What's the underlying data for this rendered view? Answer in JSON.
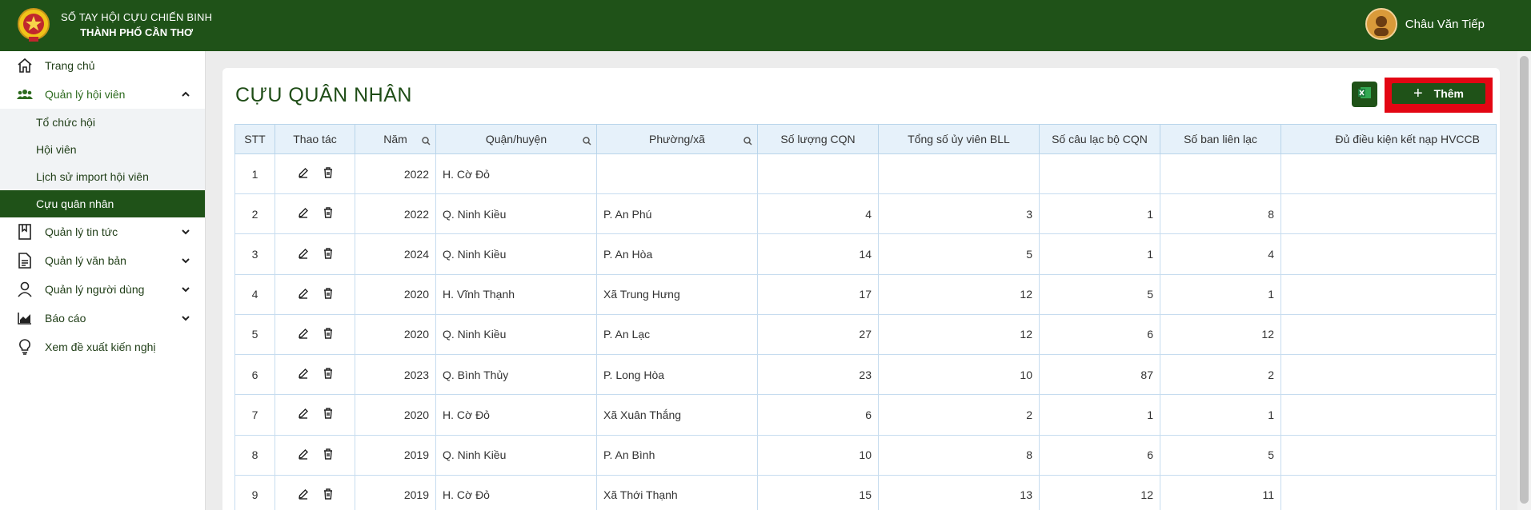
{
  "header": {
    "brand_line1": "SỔ TAY HỘI CỰU CHIẾN BINH",
    "brand_line2": "THÀNH PHỐ CẦN THƠ",
    "user_name": "Châu Văn Tiếp",
    "accent": "#1f5218"
  },
  "sidebar": {
    "items": [
      {
        "label": "Trang chủ",
        "icon": "home-icon"
      },
      {
        "label": "Quản lý hội viên",
        "icon": "users-icon"
      },
      {
        "label": "Quản lý tin tức",
        "icon": "bookmark-icon"
      },
      {
        "label": "Quản lý văn bản",
        "icon": "document-icon"
      },
      {
        "label": "Quản lý người dùng",
        "icon": "user-icon"
      },
      {
        "label": "Báo cáo",
        "icon": "chart-icon"
      },
      {
        "label": "Xem đề xuất kiến nghị",
        "icon": "lightbulb-icon"
      }
    ],
    "submenu": [
      {
        "label": "Tổ chức hội"
      },
      {
        "label": "Hội viên"
      },
      {
        "label": "Lịch sử import hội viên"
      },
      {
        "label": "Cựu quân nhân"
      }
    ]
  },
  "main": {
    "title": "CỰU QUÂN NHÂN",
    "add_label": "Thêm",
    "columns": [
      "STT",
      "Thao tác",
      "Năm",
      "Quận/huyện",
      "Phường/xã",
      "Số lượng CQN",
      "Tổng số ủy viên BLL",
      "Số câu lạc bộ CQN",
      "Số ban liên lạc",
      "Đủ điều kiện kết nạp HVCCB"
    ],
    "rows": [
      {
        "stt": "1",
        "year": "2022",
        "district": "H. Cờ Đỏ",
        "ward": "",
        "cqn": "",
        "bll": "",
        "clb": "",
        "blc": "",
        "eligible": ""
      },
      {
        "stt": "2",
        "year": "2022",
        "district": "Q. Ninh Kiều",
        "ward": "P. An Phú",
        "cqn": "4",
        "bll": "3",
        "clb": "1",
        "blc": "8",
        "eligible": ""
      },
      {
        "stt": "3",
        "year": "2024",
        "district": "Q. Ninh Kiều",
        "ward": "P. An Hòa",
        "cqn": "14",
        "bll": "5",
        "clb": "1",
        "blc": "4",
        "eligible": ""
      },
      {
        "stt": "4",
        "year": "2020",
        "district": "H. Vĩnh Thạnh",
        "ward": "Xã Trung Hưng",
        "cqn": "17",
        "bll": "12",
        "clb": "5",
        "blc": "1",
        "eligible": ""
      },
      {
        "stt": "5",
        "year": "2020",
        "district": "Q. Ninh Kiều",
        "ward": "P. An Lạc",
        "cqn": "27",
        "bll": "12",
        "clb": "6",
        "blc": "12",
        "eligible": ""
      },
      {
        "stt": "6",
        "year": "2023",
        "district": "Q. Bình Thủy",
        "ward": "P. Long Hòa",
        "cqn": "23",
        "bll": "10",
        "clb": "87",
        "blc": "2",
        "eligible": ""
      },
      {
        "stt": "7",
        "year": "2020",
        "district": "H. Cờ Đỏ",
        "ward": "Xã Xuân Thắng",
        "cqn": "6",
        "bll": "2",
        "clb": "1",
        "blc": "1",
        "eligible": ""
      },
      {
        "stt": "8",
        "year": "2019",
        "district": "Q. Ninh Kiều",
        "ward": "P. An Bình",
        "cqn": "10",
        "bll": "8",
        "clb": "6",
        "blc": "5",
        "eligible": ""
      },
      {
        "stt": "9",
        "year": "2019",
        "district": "H. Cờ Đỏ",
        "ward": "Xã Thới Thạnh",
        "cqn": "15",
        "bll": "13",
        "clb": "12",
        "blc": "11",
        "eligible": ""
      }
    ]
  }
}
